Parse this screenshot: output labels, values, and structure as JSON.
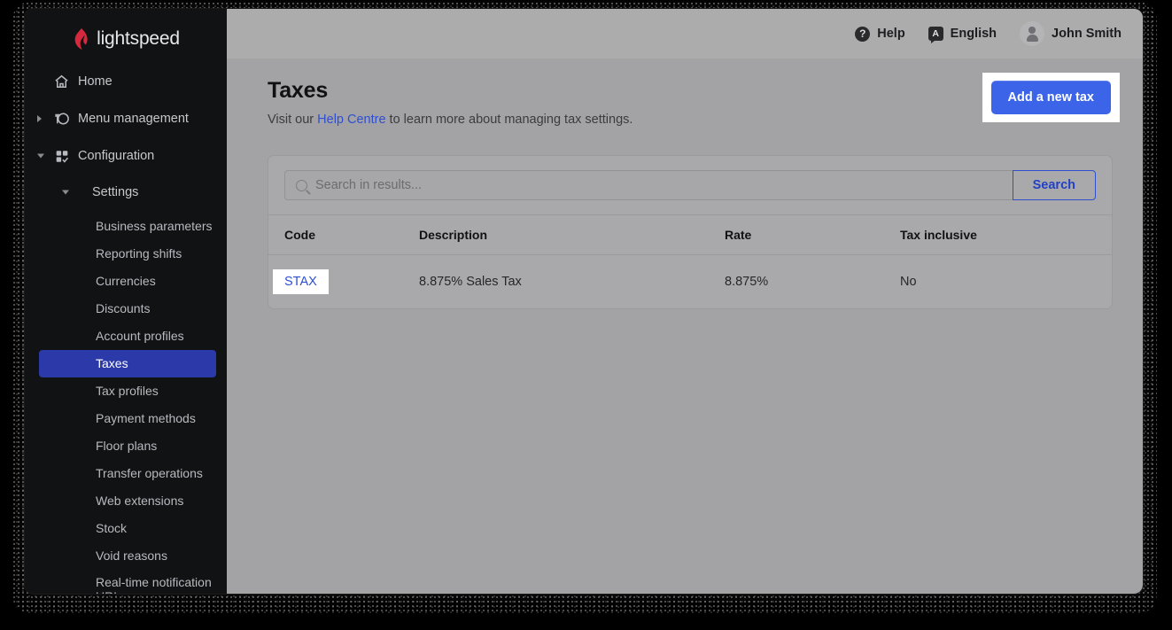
{
  "brand": {
    "name": "lightspeed",
    "logo_icon": "lightspeed-flame-icon",
    "accent": "#d6293e"
  },
  "sidebar": {
    "top_items": [
      {
        "label": "Home",
        "icon": "home-icon",
        "expandable": false,
        "expanded": false
      },
      {
        "label": "Menu management",
        "icon": "menu-dish-icon",
        "expandable": true,
        "expanded": false
      },
      {
        "label": "Configuration",
        "icon": "configuration-grid-check-icon",
        "expandable": true,
        "expanded": true
      }
    ],
    "settings": {
      "label": "Settings",
      "expanded": true
    },
    "sub_items": [
      {
        "label": "Business parameters",
        "active": false
      },
      {
        "label": "Reporting shifts",
        "active": false
      },
      {
        "label": "Currencies",
        "active": false
      },
      {
        "label": "Discounts",
        "active": false
      },
      {
        "label": "Account profiles",
        "active": false
      },
      {
        "label": "Taxes",
        "active": true
      },
      {
        "label": "Tax profiles",
        "active": false
      },
      {
        "label": "Payment methods",
        "active": false
      },
      {
        "label": "Floor plans",
        "active": false
      },
      {
        "label": "Transfer operations",
        "active": false
      },
      {
        "label": "Web extensions",
        "active": false
      },
      {
        "label": "Stock",
        "active": false
      },
      {
        "label": "Void reasons",
        "active": false
      },
      {
        "label": "Real-time notification URLs",
        "active": false
      }
    ],
    "active_color": "#2b3aa8"
  },
  "topbar": {
    "help_label": "Help",
    "help_icon": "question-mark-circle-icon",
    "language_label": "English",
    "language_icon": "language-bubble-a-icon",
    "user_name": "John Smith",
    "user_icon": "user-avatar-icon"
  },
  "page": {
    "title": "Taxes",
    "subtitle_before": "Visit our ",
    "subtitle_link": "Help Centre",
    "subtitle_after": " to learn more about managing tax settings.",
    "add_button_label": "Add a new tax",
    "add_button_color": "#3c64e8"
  },
  "search": {
    "placeholder": "Search in results...",
    "value": "",
    "icon": "search-icon",
    "button_label": "Search"
  },
  "table": {
    "columns": [
      "Code",
      "Description",
      "Rate",
      "Tax inclusive"
    ],
    "rows": [
      {
        "code": "STAX",
        "description": "8.875% Sales Tax",
        "rate": "8.875%",
        "tax_inclusive": "No"
      }
    ]
  }
}
